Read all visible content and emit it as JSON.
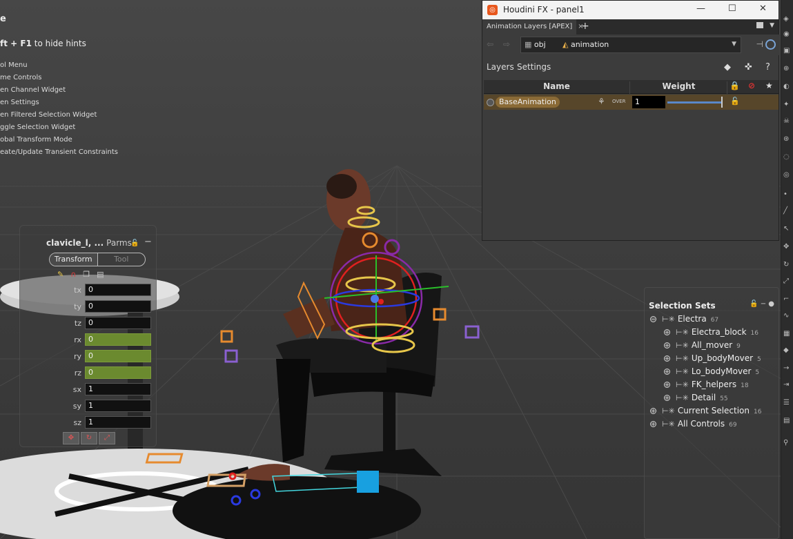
{
  "hints": {
    "title": "e",
    "main_key": "ft + F1",
    "main_text": " to hide hints",
    "items": [
      "ol Menu",
      "me Controls",
      "en Channel Widget",
      "en Settings",
      "en Filtered Selection Widget",
      "ggle Selection Widget",
      "obal Transform Mode",
      "eate/Update Transient Constraints"
    ]
  },
  "params": {
    "title": "clavicle_l, ...",
    "parms_label": "Parms",
    "tab_transform": "Transform",
    "tab_tool": "Tool",
    "rows": [
      {
        "label": "tx",
        "value": "0"
      },
      {
        "label": "ty",
        "value": "0"
      },
      {
        "label": "tz",
        "value": "0"
      },
      {
        "label": "rx",
        "value": "0"
      },
      {
        "label": "ry",
        "value": "0"
      },
      {
        "label": "rz",
        "value": "0"
      },
      {
        "label": "sx",
        "value": "1"
      },
      {
        "label": "sy",
        "value": "1"
      },
      {
        "label": "sz",
        "value": "1"
      }
    ]
  },
  "window": {
    "title": "Houdini FX - panel1",
    "minimize": "—",
    "maximize": "☐",
    "close": "✕",
    "tab_label": "Animation Layers [APEX]",
    "tab_close": "×",
    "tab_add": "+",
    "path_root": "obj",
    "path_node": "animation",
    "menu_layers": "Layers",
    "menu_settings": "Settings",
    "help": "?",
    "col_name": "Name",
    "col_weight": "Weight",
    "layer": {
      "name": "BaseAnimation",
      "mode": "OVER",
      "weight": "1",
      "weight_fraction": 1.0
    }
  },
  "selection_sets": {
    "title": "Selection Sets",
    "items": [
      {
        "name": "Electra",
        "count": "67",
        "indent": 0,
        "expanded": true
      },
      {
        "name": "Electra_block",
        "count": "16",
        "indent": 1,
        "expanded": false
      },
      {
        "name": "All_mover",
        "count": "9",
        "indent": 1,
        "expanded": false
      },
      {
        "name": "Up_bodyMover",
        "count": "5",
        "indent": 1,
        "expanded": false
      },
      {
        "name": "Lo_bodyMover",
        "count": "5",
        "indent": 1,
        "expanded": false
      },
      {
        "name": "FK_helpers",
        "count": "18",
        "indent": 1,
        "expanded": false
      },
      {
        "name": "Detail",
        "count": "55",
        "indent": 1,
        "expanded": false
      },
      {
        "name": "Current Selection",
        "count": "16",
        "indent": 0,
        "expanded": false
      },
      {
        "name": "All Controls",
        "count": "69",
        "indent": 0,
        "expanded": false
      }
    ]
  },
  "colors": {
    "accent": "#e8571d",
    "layer_row": "#57462a",
    "layer_pill": "#8a6a36",
    "param_green": "#6b8a2f"
  }
}
